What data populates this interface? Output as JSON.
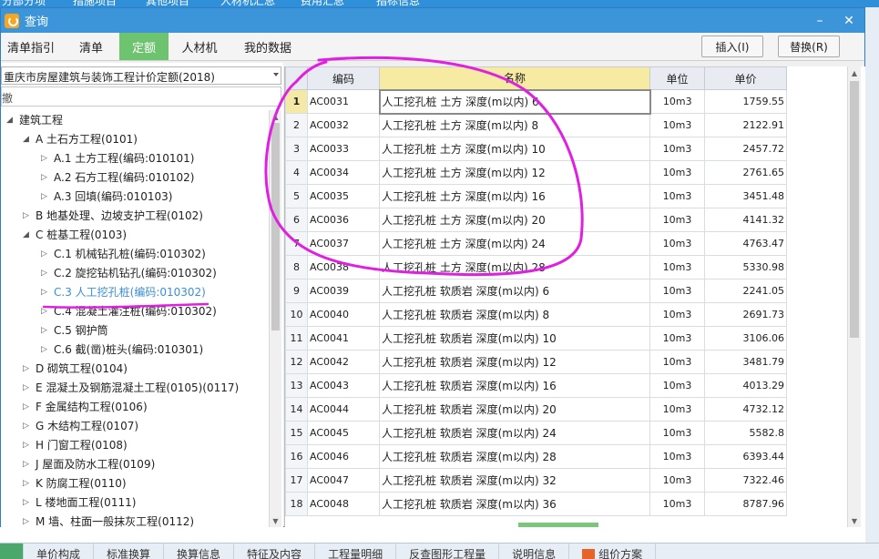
{
  "background": {
    "top_tabs": [
      "分部分项",
      "措施项目",
      "其他项目",
      "人材机汇总",
      "费用汇总",
      "指标信息"
    ],
    "bottom_tabs": [
      "",
      "单价构成",
      "标准换算",
      "换算信息",
      "特征及内容",
      "工程量明细",
      "反查图形工程量",
      "说明信息",
      "组价方案"
    ]
  },
  "dialog": {
    "title": "查询",
    "controls": {
      "minimize": "–",
      "maximize": "□",
      "close": "✕"
    }
  },
  "toolbar": {
    "tabs": [
      "清单指引",
      "清单",
      "定额",
      "人材机",
      "我的数据"
    ],
    "active_tab": "定额",
    "insert_label": "插入(I)",
    "replace_label": "替换(R)"
  },
  "left_panel": {
    "library": "重庆市房屋建筑与装饰工程计价定额(2018)",
    "search_value": "撤",
    "tree": [
      {
        "level": 0,
        "expanded": true,
        "label": "建筑工程"
      },
      {
        "level": 1,
        "expanded": true,
        "label": "A 土石方工程(0101)"
      },
      {
        "level": 2,
        "expanded": false,
        "label": "A.1 土方工程(编码:010101)"
      },
      {
        "level": 2,
        "expanded": false,
        "label": "A.2 石方工程(编码:010102)"
      },
      {
        "level": 2,
        "expanded": false,
        "label": "A.3 回填(编码:010103)"
      },
      {
        "level": 1,
        "expanded": false,
        "label": "B 地基处理、边坡支护工程(0102)"
      },
      {
        "level": 1,
        "expanded": true,
        "label": "C 桩基工程(0103)"
      },
      {
        "level": 2,
        "expanded": false,
        "label": "C.1 机械钻孔桩(编码:010302)"
      },
      {
        "level": 2,
        "expanded": false,
        "label": "C.2 旋挖钻机钻孔(编码:010302)"
      },
      {
        "level": 2,
        "expanded": false,
        "label": "C.3 人工挖孔桩(编码:010302)",
        "selected": true
      },
      {
        "level": 2,
        "expanded": false,
        "label": "C.4 混凝土灌注桩(编码:010302)"
      },
      {
        "level": 2,
        "expanded": false,
        "label": "C.5 钢护筒"
      },
      {
        "level": 2,
        "expanded": false,
        "label": "C.6 截(凿)桩头(编码:010301)"
      },
      {
        "level": 1,
        "expanded": false,
        "label": "D 砌筑工程(0104)"
      },
      {
        "level": 1,
        "expanded": false,
        "label": "E 混凝土及钢筋混凝土工程(0105)(0117)"
      },
      {
        "level": 1,
        "expanded": false,
        "label": "F 金属结构工程(0106)"
      },
      {
        "level": 1,
        "expanded": false,
        "label": "G 木结构工程(0107)"
      },
      {
        "level": 1,
        "expanded": false,
        "label": "H 门窗工程(0108)"
      },
      {
        "level": 1,
        "expanded": false,
        "label": "J 屋面及防水工程(0109)"
      },
      {
        "level": 1,
        "expanded": false,
        "label": "K 防腐工程(0110)"
      },
      {
        "level": 1,
        "expanded": false,
        "label": "L 楼地面工程(0111)"
      },
      {
        "level": 1,
        "expanded": false,
        "label": "M 墙、柱面一般抹灰工程(0112)"
      }
    ]
  },
  "grid": {
    "headers": [
      "",
      "编码",
      "名称",
      "单位",
      "单价"
    ],
    "current_row": 1,
    "rows": [
      {
        "n": "1",
        "code": "AC0031",
        "name": "人工挖孔桩 土方 深度(m以内) 6",
        "unit": "10m3",
        "price": "1759.55"
      },
      {
        "n": "2",
        "code": "AC0032",
        "name": "人工挖孔桩 土方 深度(m以内) 8",
        "unit": "10m3",
        "price": "2122.91"
      },
      {
        "n": "3",
        "code": "AC0033",
        "name": "人工挖孔桩 土方 深度(m以内) 10",
        "unit": "10m3",
        "price": "2457.72"
      },
      {
        "n": "4",
        "code": "AC0034",
        "name": "人工挖孔桩 土方 深度(m以内) 12",
        "unit": "10m3",
        "price": "2761.65"
      },
      {
        "n": "5",
        "code": "AC0035",
        "name": "人工挖孔桩 土方 深度(m以内) 16",
        "unit": "10m3",
        "price": "3451.48"
      },
      {
        "n": "6",
        "code": "AC0036",
        "name": "人工挖孔桩 土方 深度(m以内) 20",
        "unit": "10m3",
        "price": "4141.32"
      },
      {
        "n": "7",
        "code": "AC0037",
        "name": "人工挖孔桩 土方 深度(m以内) 24",
        "unit": "10m3",
        "price": "4763.47"
      },
      {
        "n": "8",
        "code": "AC0038",
        "name": "人工挖孔桩 土方 深度(m以内) 28",
        "unit": "10m3",
        "price": "5330.98"
      },
      {
        "n": "9",
        "code": "AC0039",
        "name": "人工挖孔桩 软质岩 深度(m以内) 6",
        "unit": "10m3",
        "price": "2241.05"
      },
      {
        "n": "10",
        "code": "AC0040",
        "name": "人工挖孔桩 软质岩 深度(m以内) 8",
        "unit": "10m3",
        "price": "2691.73"
      },
      {
        "n": "11",
        "code": "AC0041",
        "name": "人工挖孔桩 软质岩 深度(m以内) 10",
        "unit": "10m3",
        "price": "3106.06"
      },
      {
        "n": "12",
        "code": "AC0042",
        "name": "人工挖孔桩 软质岩 深度(m以内) 12",
        "unit": "10m3",
        "price": "3481.79"
      },
      {
        "n": "13",
        "code": "AC0043",
        "name": "人工挖孔桩 软质岩 深度(m以内) 16",
        "unit": "10m3",
        "price": "4013.29"
      },
      {
        "n": "14",
        "code": "AC0044",
        "name": "人工挖孔桩 软质岩 深度(m以内) 20",
        "unit": "10m3",
        "price": "4732.12"
      },
      {
        "n": "15",
        "code": "AC0045",
        "name": "人工挖孔桩 软质岩 深度(m以内) 24",
        "unit": "10m3",
        "price": "5582.8"
      },
      {
        "n": "16",
        "code": "AC0046",
        "name": "人工挖孔桩 软质岩 深度(m以内) 28",
        "unit": "10m3",
        "price": "6393.44"
      },
      {
        "n": "17",
        "code": "AC0047",
        "name": "人工挖孔桩 软质岩 深度(m以内) 32",
        "unit": "10m3",
        "price": "7322.46"
      },
      {
        "n": "18",
        "code": "AC0048",
        "name": "人工挖孔桩 软质岩 深度(m以内) 36",
        "unit": "10m3",
        "price": "8787.96"
      }
    ]
  },
  "colors": {
    "titlebar": "#3d95d9",
    "active_tab": "#6ec36e",
    "selected_tree_item": "#3a8fd6",
    "header_highlight": "#f7eaa3",
    "annotation": "#e020e0"
  }
}
